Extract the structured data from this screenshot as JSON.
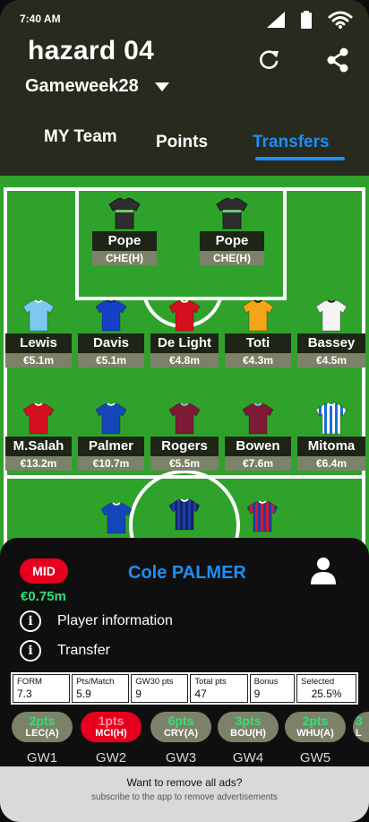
{
  "status": {
    "time": "7:40 AM"
  },
  "header": {
    "team_name": "hazard 04",
    "gameweek": "Gameweek28"
  },
  "tabs": [
    {
      "label": "MY Team",
      "active": false
    },
    {
      "label": "Points",
      "active": false
    },
    {
      "label": "Transfers",
      "active": true
    }
  ],
  "colors": {
    "accent": "#1e8ef5",
    "pitch": "#2fa22c",
    "badge": "#e6001e",
    "positive": "#2fe07a"
  },
  "goalkeepers": [
    {
      "name": "Pope",
      "info": "CHE(H)",
      "shirt": "goalkeeper-kit"
    },
    {
      "name": "Pope",
      "info": "CHE(H)",
      "shirt": "goalkeeper-kit"
    }
  ],
  "defenders": [
    {
      "name": "Lewis",
      "info": "€5.1m",
      "shirt": "sky-blue-kit"
    },
    {
      "name": "Davis",
      "info": "€5.1m",
      "shirt": "royal-blue-kit"
    },
    {
      "name": "De Light",
      "info": "€4.8m",
      "shirt": "red-kit"
    },
    {
      "name": "Toti",
      "info": "€4.3m",
      "shirt": "gold-kit"
    },
    {
      "name": "Bassey",
      "info": "€4.5m",
      "shirt": "white-kit"
    }
  ],
  "midfielders": [
    {
      "name": "M.Salah",
      "info": "€13.2m",
      "shirt": "red-kit"
    },
    {
      "name": "Palmer",
      "info": "€10.7m",
      "shirt": "blue-kit"
    },
    {
      "name": "Rogers",
      "info": "€5.5m",
      "shirt": "claret-kit"
    },
    {
      "name": "Bowen",
      "info": "€7.6m",
      "shirt": "claret-kit"
    },
    {
      "name": "Mitoma",
      "info": "€6.4m",
      "shirt": "striped-blue-kit"
    }
  ],
  "forwards": [
    {
      "shirt": "blue-kit"
    },
    {
      "shirt": "striped-blue-kit"
    },
    {
      "shirt": "striped-red-blue-kit"
    }
  ],
  "sheet": {
    "position": "MID",
    "player_name": "Cole PALMER",
    "price": "€0.75m",
    "menu": [
      {
        "label": "Player information",
        "icon": "info-icon"
      },
      {
        "label": "Transfer",
        "icon": "info-icon"
      }
    ],
    "stats": [
      {
        "label": "FORM",
        "value": "7.3"
      },
      {
        "label": "Pts/Match",
        "value": "5.9"
      },
      {
        "label": "GW30 pts",
        "value": "9"
      },
      {
        "label": "Total pts",
        "value": "47"
      },
      {
        "label": "Bonus",
        "value": "9"
      },
      {
        "label": "Selected",
        "value": "25.5%"
      }
    ],
    "fixtures": [
      {
        "pts": "2pts",
        "opp": "LEC(A)",
        "gw": "GW1",
        "hard": false
      },
      {
        "pts": "1pts",
        "opp": "MCI(H)",
        "gw": "GW2",
        "hard": true
      },
      {
        "pts": "6pts",
        "opp": "CRY(A)",
        "gw": "GW3",
        "hard": false
      },
      {
        "pts": "3pts",
        "opp": "BOU(H)",
        "gw": "GW4",
        "hard": false
      },
      {
        "pts": "2pts",
        "opp": "WHU(A)",
        "gw": "GW5",
        "hard": false
      },
      {
        "pts": "3",
        "opp": "L",
        "gw": "",
        "hard": false
      }
    ]
  },
  "ad": {
    "title": "Want to remove all ads?",
    "subtitle": "subscribe to the app to remove advertisements"
  }
}
